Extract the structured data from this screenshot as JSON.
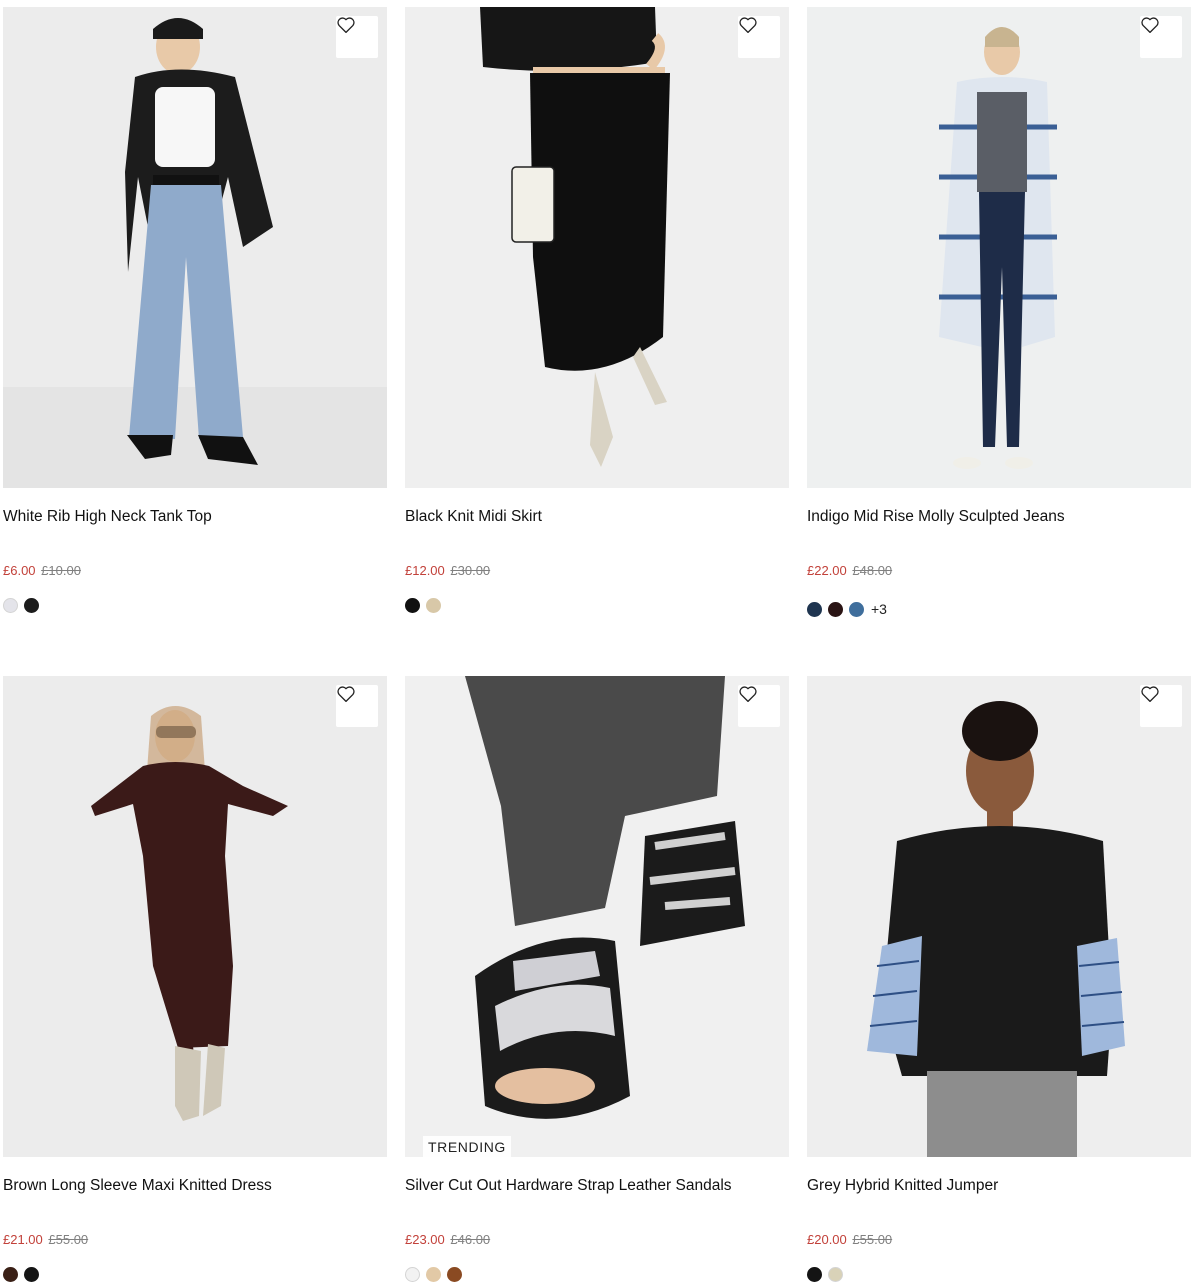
{
  "products": [
    {
      "name": "White Rib High Neck Tank Top",
      "price": "£6.00",
      "was": "£10.00",
      "swatches": [
        "#e4e4ea",
        "#1c1c1c"
      ],
      "more": "",
      "badge": "",
      "image_desc": "woman-white-top-black-blazer-jeans"
    },
    {
      "name": "Black Knit Midi Skirt",
      "price": "£12.00",
      "was": "£30.00",
      "swatches": [
        "#111111",
        "#d8c8a8"
      ],
      "more": "",
      "badge": "",
      "image_desc": "black-knit-skirt-snakeskin-heels"
    },
    {
      "name": "Indigo Mid Rise Molly Sculpted Jeans",
      "price": "£22.00",
      "was": "£48.00",
      "swatches": [
        "#1f3550",
        "#2a1414",
        "#3f6e9c"
      ],
      "more": "+3",
      "badge": "",
      "image_desc": "woman-check-coat-dark-jeans"
    },
    {
      "name": "Brown Long Sleeve Maxi Knitted Dress",
      "price": "£21.00",
      "was": "£55.00",
      "swatches": [
        "#3a2016",
        "#151515"
      ],
      "more": "",
      "badge": "",
      "image_desc": "woman-brown-knit-dress-boots"
    },
    {
      "name": "Silver Cut Out Hardware Strap Leather Sandals",
      "price": "£23.00",
      "was": "£46.00",
      "swatches": [
        "#f2f2f2",
        "#e2c9a6",
        "#8a4a22"
      ],
      "more": "",
      "badge": "TRENDING",
      "image_desc": "silver-strap-sandals-grey-jeans"
    },
    {
      "name": "Grey Hybrid Knitted Jumper",
      "price": "£20.00",
      "was": "£55.00",
      "swatches": [
        "#141414",
        "#d9d2b8"
      ],
      "more": "",
      "badge": "",
      "image_desc": "woman-black-cable-jumper-striped-sleeves"
    }
  ],
  "icons": {
    "wishlist": "heart-outline-icon"
  }
}
